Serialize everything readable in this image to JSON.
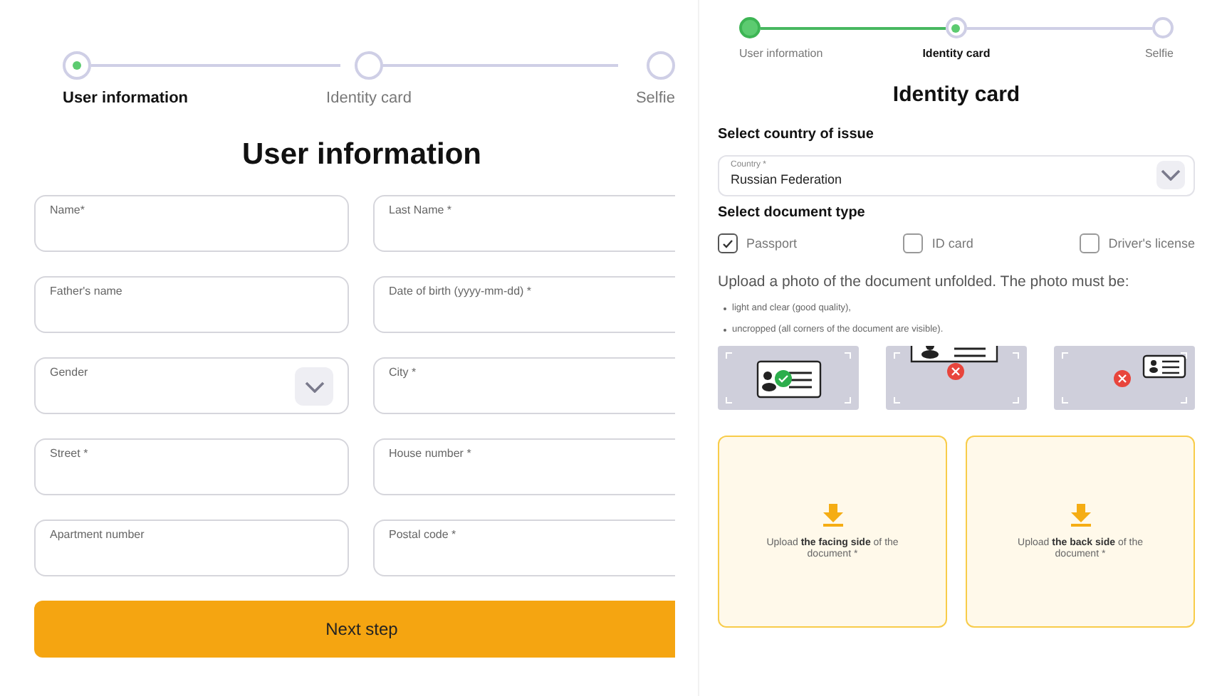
{
  "user_form": {
    "steps": [
      {
        "label": "User information",
        "selected": true,
        "completed": false
      },
      {
        "label": "Identity card",
        "selected": false,
        "completed": false
      },
      {
        "label": "Selfie",
        "selected": false,
        "completed": false
      }
    ],
    "title": "User information",
    "fields": [
      {
        "kind": "text",
        "placeholder": "Name*"
      },
      {
        "kind": "text",
        "placeholder": "Last Name *"
      },
      {
        "kind": "text",
        "placeholder": "Father's name"
      },
      {
        "kind": "text",
        "placeholder": "Date of birth (yyyy-mm-dd) *"
      },
      {
        "kind": "select",
        "placeholder": "Gender"
      },
      {
        "kind": "text",
        "placeholder": "City *"
      },
      {
        "kind": "text",
        "placeholder": "Street *"
      },
      {
        "kind": "text",
        "placeholder": "House number *"
      },
      {
        "kind": "text",
        "placeholder": "Apartment number"
      },
      {
        "kind": "text",
        "placeholder": "Postal code *"
      }
    ],
    "next_button": "Next step"
  },
  "identity_form": {
    "steps": [
      {
        "label": "User information",
        "selected": false,
        "completed": true
      },
      {
        "label": "Identity card",
        "selected": true,
        "completed": false
      },
      {
        "label": "Selfie",
        "selected": false,
        "completed": false
      }
    ],
    "title": "Identity card",
    "country_heading": "Select country of issue",
    "country": {
      "label": "Country *",
      "value": "Russian Federation"
    },
    "document_heading": "Select document type",
    "document_types": [
      {
        "label": "Passport",
        "checked": true
      },
      {
        "label": "ID card",
        "checked": false
      },
      {
        "label": "Driver's license",
        "checked": false
      }
    ],
    "instructions": "Upload a photo of the document unfolded. The photo must be:",
    "requirements": [
      "light and clear (good quality),",
      "uncropped (all corners of the document are visible)."
    ],
    "examples": [
      {
        "kind": "centered",
        "valid": true
      },
      {
        "kind": "cropped",
        "valid": false
      },
      {
        "kind": "small",
        "valid": false
      }
    ],
    "uploads": [
      "Upload **the facing side** of the document *",
      "Upload **the back side** of the document *"
    ]
  }
}
